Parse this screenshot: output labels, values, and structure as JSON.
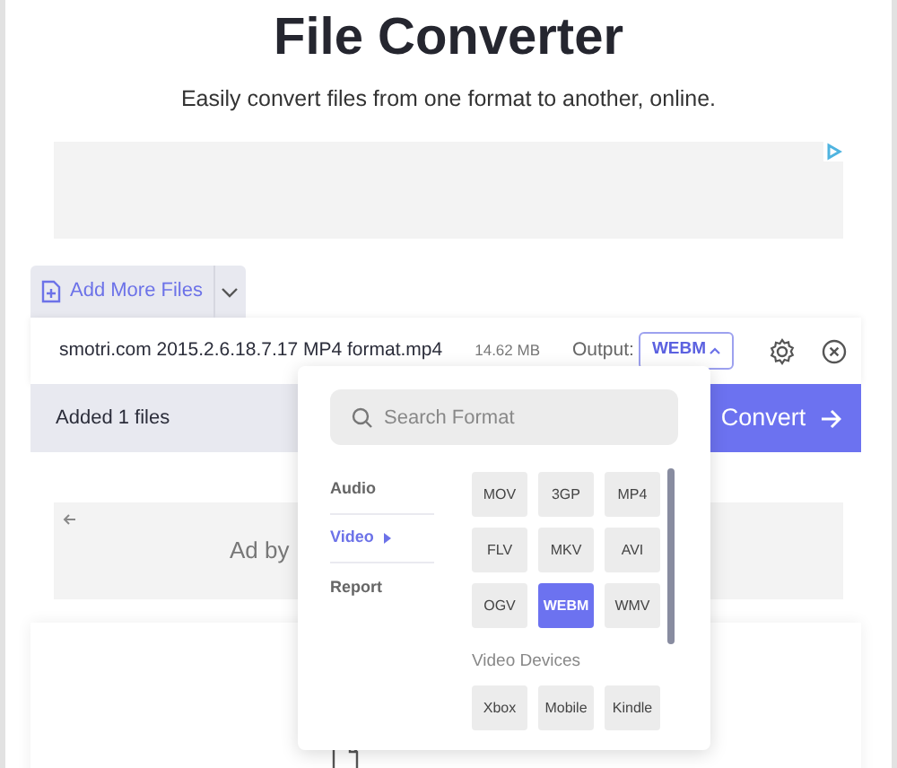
{
  "title": "File Converter",
  "subtitle": "Easily convert files from one format to another, online.",
  "upload_tab": {
    "label": "Add More Files"
  },
  "file": {
    "name": "smotri.com 2015.2.6.18.7.17 MP4 format.mp4",
    "size": "14.62 MB",
    "output_label": "Output:",
    "output_value": "WEBM",
    "expanded": true
  },
  "footer": {
    "status": "Added 1 files",
    "convert_button": "Convert"
  },
  "ad": {
    "label": "Ad by"
  },
  "format_menu": {
    "search": {
      "placeholder": "Search Format"
    },
    "categories": [
      {
        "label": "Audio",
        "selected": false
      },
      {
        "label": "Video",
        "selected": true
      },
      {
        "label": "Report",
        "selected": false
      }
    ],
    "formats": [
      {
        "label": "MOV",
        "selected": false
      },
      {
        "label": "3GP",
        "selected": false
      },
      {
        "label": "MP4",
        "selected": false
      },
      {
        "label": "FLV",
        "selected": false
      },
      {
        "label": "MKV",
        "selected": false
      },
      {
        "label": "AVI",
        "selected": false
      },
      {
        "label": "OGV",
        "selected": false
      },
      {
        "label": "WEBM",
        "selected": true
      },
      {
        "label": "WMV",
        "selected": false
      }
    ],
    "devices_heading": "Video Devices",
    "devices": [
      {
        "label": "Xbox",
        "selected": false
      },
      {
        "label": "Mobile",
        "selected": false
      },
      {
        "label": "Kindle",
        "selected": false
      }
    ]
  }
}
